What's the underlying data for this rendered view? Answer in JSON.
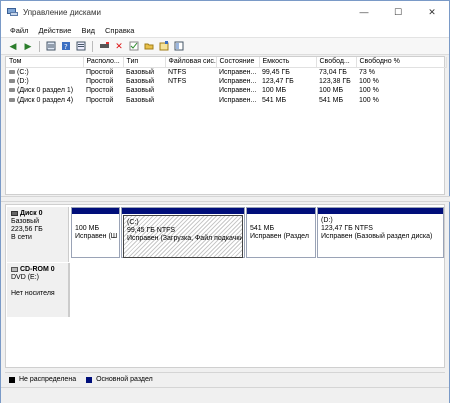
{
  "window": {
    "title": "Управление дисками",
    "minimize": "—",
    "maximize": "☐",
    "close": "✕"
  },
  "menu": [
    "Файл",
    "Действие",
    "Вид",
    "Справка"
  ],
  "table": {
    "columns": [
      "Том",
      "Располо...",
      "Тип",
      "Файловая сис...",
      "Состояние",
      "Емкость",
      "Свобод...",
      "Свободно %"
    ],
    "rows": [
      [
        "(C:)",
        "Простой",
        "Базовый",
        "NTFS",
        "Исправен...",
        "99,45 ГБ",
        "73,04 ГБ",
        "73 %"
      ],
      [
        "(D:)",
        "Простой",
        "Базовый",
        "NTFS",
        "Исправен...",
        "123,47 ГБ",
        "123,38 ГБ",
        "100 %"
      ],
      [
        "(Диск 0 раздел 1)",
        "Простой",
        "Базовый",
        "",
        "Исправен...",
        "100 МБ",
        "100 МБ",
        "100 %"
      ],
      [
        "(Диск 0 раздел 4)",
        "Простой",
        "Базовый",
        "",
        "Исправен...",
        "541 МБ",
        "541 МБ",
        "100 %"
      ]
    ]
  },
  "disk0": {
    "name": "Диск 0",
    "type": "Базовый",
    "size": "223,56 ГБ",
    "state": "В сети",
    "partitions": [
      {
        "label": "",
        "size": "100 МБ",
        "status": "Исправен (Ш"
      },
      {
        "label": "(C:)",
        "size": "99,45 ГБ NTFS",
        "status": "Исправен (Загрузка, Файл подкачки"
      },
      {
        "label": "",
        "size": "541 МБ",
        "status": "Исправен (Раздел"
      },
      {
        "label": "(D:)",
        "size": "123,47 ГБ NTFS",
        "status": "Исправен (Базовый раздел диска)"
      }
    ]
  },
  "cdrom0": {
    "name": "CD-ROM 0",
    "drive": "DVD (E:)",
    "state": "Нет носителя"
  },
  "legend": [
    {
      "label": "Не распределена",
      "color": "#000000"
    },
    {
      "label": "Основной раздел",
      "color": "#000e7a"
    }
  ]
}
